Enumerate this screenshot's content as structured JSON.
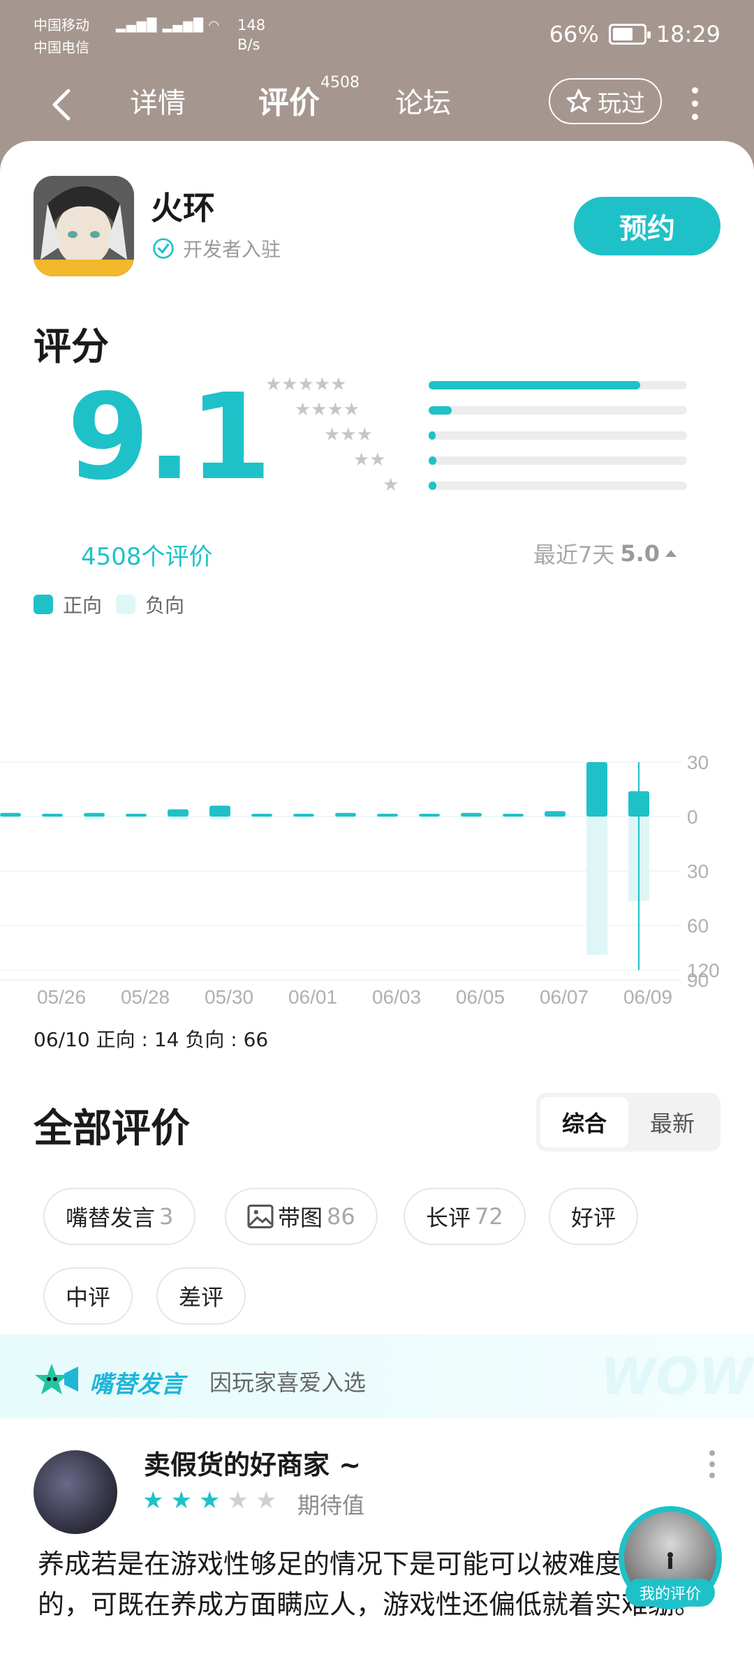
{
  "status": {
    "carrier1": "中国移动",
    "carrier2": "中国电信",
    "net": "4G 5G",
    "speed1": "148",
    "speed2": "B/s",
    "battery": "66%",
    "battery_level": 0.66,
    "time": "18:29"
  },
  "nav": {
    "tabs": [
      "详情",
      "评价",
      "论坛"
    ],
    "active_tab": "评价",
    "review_badge": "4508",
    "played": "玩过"
  },
  "game": {
    "name": "火环",
    "dev_badge": "开发者入驻",
    "reserve": "预约"
  },
  "score": {
    "title": "评分",
    "value": "9.1",
    "count_text": "4508个评价",
    "recent_label": "最近7天",
    "recent_value": "5.0",
    "distribution": [
      {
        "stars": 5,
        "fraction": 0.82
      },
      {
        "stars": 4,
        "fraction": 0.09
      },
      {
        "stars": 3,
        "fraction": 0.02
      },
      {
        "stars": 2,
        "fraction": 0.03
      },
      {
        "stars": 1,
        "fraction": 0.03
      }
    ]
  },
  "legend": {
    "positive": "正向",
    "negative": "负向"
  },
  "colors": {
    "accent": "#1fc1c8",
    "accent_light": "#dff6f7",
    "track": "#ececec"
  },
  "chart_data": {
    "type": "bar",
    "categories": [
      "05/25",
      "05/26",
      "05/27",
      "05/28",
      "05/29",
      "05/30",
      "05/31",
      "06/01",
      "06/02",
      "06/03",
      "06/04",
      "06/05",
      "06/06",
      "06/07",
      "06/08",
      "06/09",
      "06/10"
    ],
    "x_tick_labels": [
      "05/26",
      "05/28",
      "05/30",
      "06/01",
      "06/03",
      "06/05",
      "06/07",
      "06/09"
    ],
    "series": [
      {
        "name": "正向",
        "values": [
          2,
          0,
          2,
          0,
          4,
          6,
          0,
          0,
          2,
          0,
          1,
          2,
          1,
          3,
          30,
          14
        ]
      },
      {
        "name": "负向",
        "values": [
          0,
          1,
          2,
          0,
          2,
          2,
          0,
          0,
          1,
          0,
          1,
          1,
          0,
          1,
          108,
          66
        ]
      }
    ],
    "y_ticks_positive": [
      30,
      0
    ],
    "y_ticks_negative": [
      30,
      60,
      90,
      120
    ],
    "ylim_positive": [
      0,
      30
    ],
    "ylim_negative": [
      0,
      120
    ]
  },
  "daily_summary": "06/10 正向 : 14  负向 : 66",
  "reviews": {
    "title": "全部评价",
    "sort_options": [
      "综合",
      "最新"
    ],
    "active_sort": "综合",
    "filters": [
      {
        "label": "嘴替发言",
        "count": "3",
        "icon": "image"
      },
      {
        "label": "带图",
        "count": "86",
        "icon": "picture-icon"
      },
      {
        "label": "长评",
        "count": "72"
      },
      {
        "label": "好评",
        "count": ""
      },
      {
        "label": "中评",
        "count": ""
      },
      {
        "label": "差评",
        "count": ""
      }
    ],
    "promo_brand": "嘴替发言",
    "promo_text": "因玩家喜爱入选",
    "promo_wow": "WOW!",
    "item": {
      "user": "卖假货的好商家 ~",
      "rating": 3,
      "rating_label": "期待值",
      "text": "养成若是在游戏性够足的情况下是可能可以被难度问题的，可既在养成方面瞒应人，游戏性还偏低就着实难绷。"
    },
    "my_review": "我的评价"
  }
}
